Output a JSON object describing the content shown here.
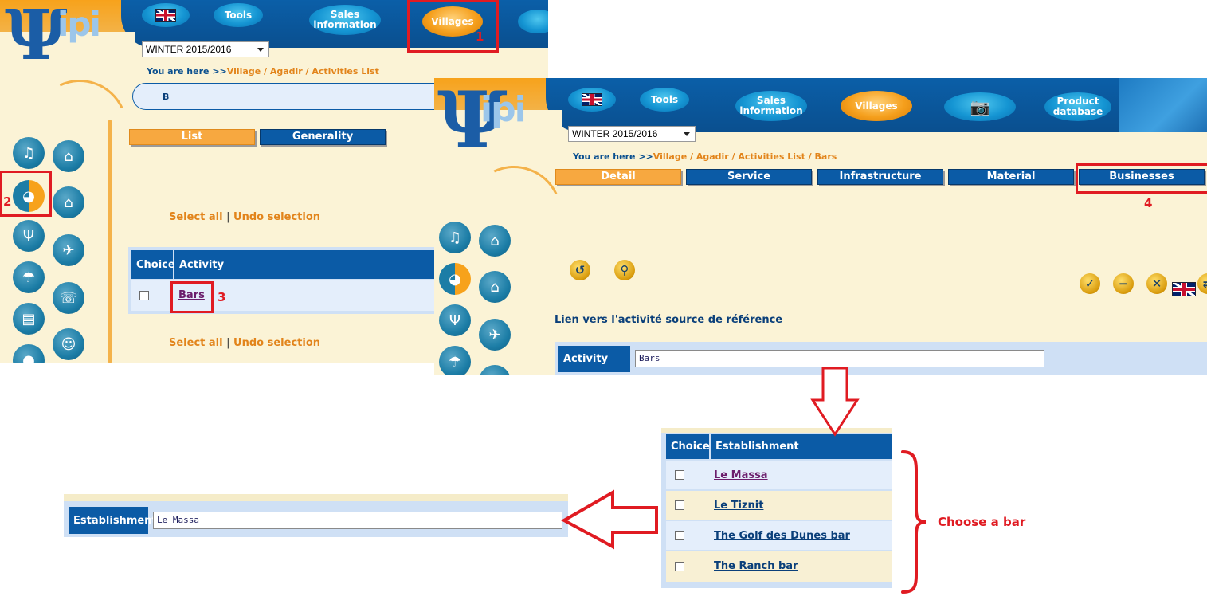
{
  "app_left": {
    "logo_text": "ipi",
    "nav": {
      "flag": "english-flag",
      "tools": "Tools",
      "sales": "Sales\ninformation",
      "villages": "Villages"
    },
    "season_select": "WINTER 2015/2016",
    "breadcrumb": {
      "prefix": "You are here >>",
      "path": "Village / Agadir / Activities List"
    },
    "search_value": "B",
    "tabs": [
      "List",
      "Generality"
    ],
    "select_all": "Select all",
    "separator": "|",
    "undo_selection": "Undo selection",
    "table": {
      "headers": [
        "Choice",
        "Activity"
      ],
      "rows": [
        {
          "activity": "Bars"
        }
      ]
    }
  },
  "app_right": {
    "logo_text": "ipi",
    "nav": {
      "tools": "Tools",
      "sales": "Sales\ninformation",
      "villages": "Villages",
      "camera": "camera-icon",
      "product": "Product\ndatabase"
    },
    "season_select": "WINTER 2015/2016",
    "breadcrumb": {
      "prefix": "You are here >>",
      "path": "Village / Agadir / Activities List / Bars"
    },
    "tabs": [
      "Detail",
      "Service",
      "Infrastructure",
      "Material",
      "Businesses"
    ],
    "source_link": "Lien vers l'activité source de référence",
    "activity_label": "Activity",
    "activity_value": "Bars"
  },
  "establishments": {
    "headers": [
      "Choice",
      "Establishment"
    ],
    "rows": [
      "Le Massa",
      "Le Tiznit",
      "The Golf des Dunes bar",
      "The Ranch bar"
    ]
  },
  "result": {
    "label": "Establishment",
    "value": "Le Massa"
  },
  "annotations": {
    "step1": "1",
    "step2": "2",
    "step3": "3",
    "step4": "4",
    "choose": "Choose a bar"
  },
  "colors": {
    "annotation_red": "#e01b22",
    "nav_blue": "#0b5ba6",
    "accent_orange": "#f7a840",
    "cream": "#fbf3d6"
  }
}
